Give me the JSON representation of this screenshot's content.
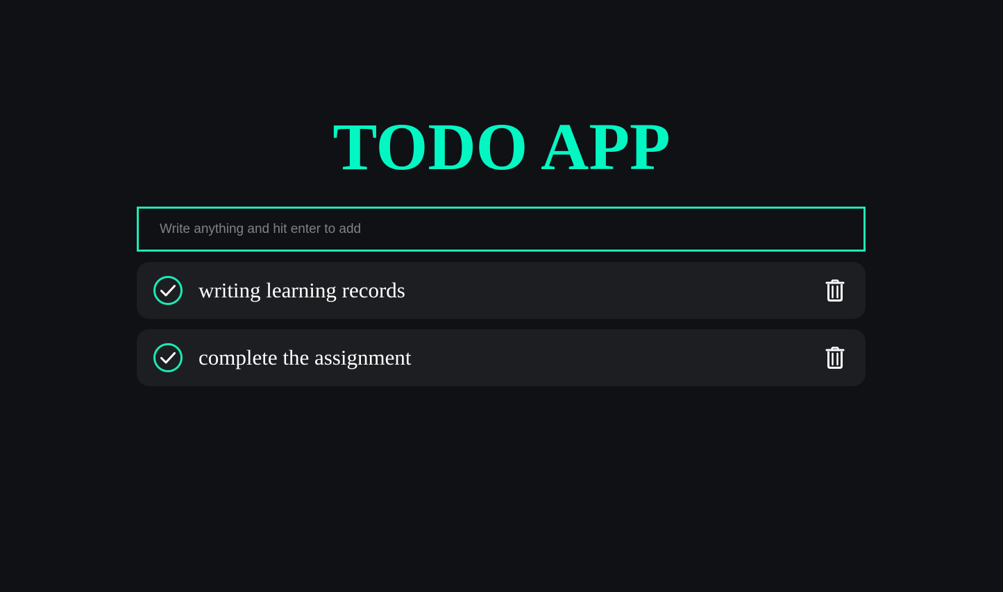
{
  "app": {
    "title": "TODO APP"
  },
  "input": {
    "placeholder": "Write anything and hit enter to add",
    "value": ""
  },
  "todos": [
    {
      "text": "writing learning records",
      "status_icon": "check-circle-icon",
      "action_icon": "trash-icon"
    },
    {
      "text": "complete the assignment",
      "status_icon": "check-circle-icon",
      "action_icon": "trash-icon"
    }
  ],
  "colors": {
    "background": "#101115",
    "accent": "#03f7c3",
    "input_border": "#1de9b6",
    "item_background": "#1d1e22",
    "text": "#ffffff",
    "placeholder": "#7f8186"
  }
}
